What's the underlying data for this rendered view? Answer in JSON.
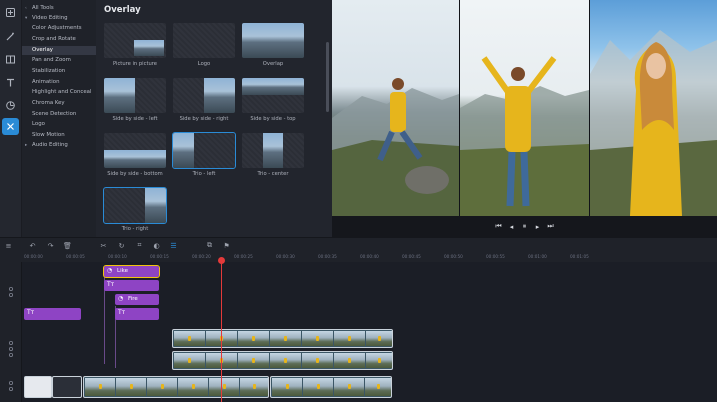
{
  "tools_menu": {
    "items": [
      {
        "label": "All Tools",
        "type": "cat"
      },
      {
        "label": "Video Editing",
        "type": "cat"
      },
      {
        "label": "Color Adjustments"
      },
      {
        "label": "Crop and Rotate"
      },
      {
        "label": "Overlay",
        "selected": true
      },
      {
        "label": "Pan and Zoom"
      },
      {
        "label": "Stabilization"
      },
      {
        "label": "Animation"
      },
      {
        "label": "Highlight and Conceal"
      },
      {
        "label": "Chroma Key"
      },
      {
        "label": "Scene Detection"
      },
      {
        "label": "Logo"
      },
      {
        "label": "Slow Motion"
      },
      {
        "label": "Audio Editing",
        "type": "cat"
      }
    ]
  },
  "overlay_panel": {
    "title": "Overlay",
    "options": [
      {
        "label": "Picture in picture"
      },
      {
        "label": "Logo"
      },
      {
        "label": "Overlap"
      },
      {
        "label": "Side by side - left"
      },
      {
        "label": "Side by side - right"
      },
      {
        "label": "Side by side - top"
      },
      {
        "label": "Side by side - bottom"
      },
      {
        "label": "Trio - left",
        "selected": true
      },
      {
        "label": "Trio - center"
      },
      {
        "label": "Trio - right"
      }
    ]
  },
  "timeline": {
    "ruler_ticks": [
      "00:00:00",
      "00:00:05",
      "00:00:10",
      "00:00:15",
      "00:00:20",
      "00:00:25",
      "00:00:30",
      "00:00:35",
      "00:00:40",
      "00:00:45",
      "00:00:50",
      "00:00:55",
      "00:01:00",
      "00:01:05"
    ],
    "clips": {
      "like": "Like",
      "fire": "Fire"
    }
  },
  "icons": {
    "rail": [
      "import-icon",
      "magic-wand-icon",
      "transitions-icon",
      "titles-icon",
      "stickers-icon",
      "more-tools-icon"
    ],
    "toolbar": [
      "undo-icon",
      "redo-icon",
      "delete-icon",
      "cut-icon",
      "rotate-icon",
      "crop-icon",
      "color-adjust-icon",
      "clip-properties-icon",
      "overlay-icon",
      "marker-icon"
    ],
    "player": [
      "skip-start-icon",
      "frame-back-icon",
      "pause-icon",
      "frame-forward-icon",
      "skip-end-icon"
    ]
  },
  "colors": {
    "accent": "#2a8bd6",
    "title_clip": "#8e44c4",
    "playhead": "#e43a3a",
    "selection": "#f1c40f"
  }
}
